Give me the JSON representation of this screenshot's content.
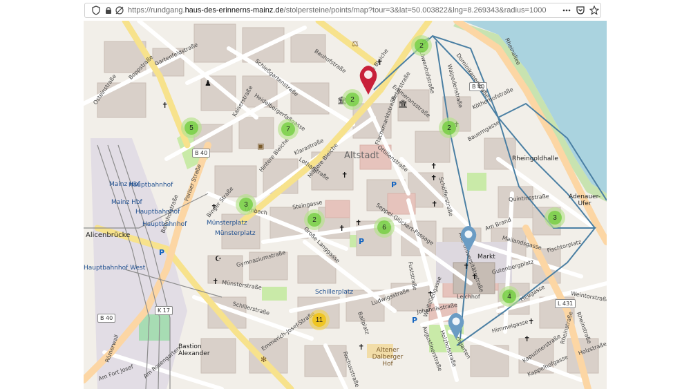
{
  "browser": {
    "url_prefix": "https://rundgang.",
    "url_domain": "haus-des-erinnerns-mainz.de",
    "url_suffix": "/stolpersteine/points/map?tour=3&lat=50.003822&lng=8.269343&radius=1000"
  },
  "map": {
    "district_label": "Altstadt",
    "clusters": [
      {
        "count": "2"
      },
      {
        "count": "2"
      },
      {
        "count": "2"
      },
      {
        "count": "5"
      },
      {
        "count": "7"
      },
      {
        "count": "3"
      },
      {
        "count": "2"
      },
      {
        "count": "6"
      },
      {
        "count": "3"
      },
      {
        "count": "4"
      },
      {
        "count": "11"
      }
    ],
    "road_refs": [
      "B 40",
      "B 40",
      "B 40",
      "K 17",
      "L 431"
    ],
    "places": [
      "Mainz Hbf",
      "Hauptbahnhof",
      "Hauptbahnhof",
      "Mainz Hbf",
      "Hauptbahnhof",
      "Hauptbahnhof West",
      "Münsterplatz",
      "Münsterplatz",
      "Alicenbrücke",
      "Markt",
      "Rheingoldhalle",
      "Adenauer-Ufer",
      "Bastion Alexander",
      "Schillerplatz",
      "Altener Dalberger Hof"
    ],
    "streets": [
      "Boppstraße",
      "Gartenfeldstraße",
      "Osteinstraße",
      "Kaiserstraße",
      "Schießgartenstraße",
      "Bauhofstraße",
      "Große Bleiche",
      "Heidelbergerfaßgasse",
      "Hintere Bleiche",
      "Mittlere Bleiche",
      "Lotharstraße",
      "Klarastraße",
      "Flachsmarktstraße",
      "Ottilienstraße",
      "Steingasse",
      "Umbach",
      "Binger Straße",
      "Große Langgasse",
      "Münsterstraße",
      "Schillerstraße",
      "Emmerich-Josef-Straße",
      "Ballplatz",
      "Augustinerstraße",
      "Weißliliengasse",
      "Ludwigsstraße",
      "Seppel-Glückert-Passage",
      "Quintinsstraße",
      "Am Brand",
      "Mailandsgasse",
      "Fischtorplatz",
      "Rheinstraße",
      "Heugasse",
      "Himmelgasse",
      "Kapuzinerstraße",
      "Holzhofstraße",
      "Johannisstraße",
      "Kirschgarten",
      "Fuststraße",
      "Rheinallee",
      "Peterstraße",
      "Löwenhofstraße",
      "Walpodenstraße",
      "Dominikanerstraße",
      "Bauerngasse",
      "Emmeransstraße",
      "Kötherhofstraße",
      "Schöfferstraße",
      "Gymnasiumstraße",
      "Römerwall",
      "Am Fort Josef",
      "Alte Universitätsstraße",
      "Rheinstraße",
      "Weintorstraße",
      "Holzstraße",
      "Kappelhofgasse",
      "Leichhof",
      "Gutenbergplatz",
      "Pariser Straße",
      "Rochusstraße",
      "Am Rosengarten",
      "Bahnhofstraße"
    ],
    "colors": {
      "route": "#4a7fa3",
      "red_pin": "#c8203a",
      "blue_pin": "#6b9cc4",
      "water": "#aad3df"
    }
  }
}
